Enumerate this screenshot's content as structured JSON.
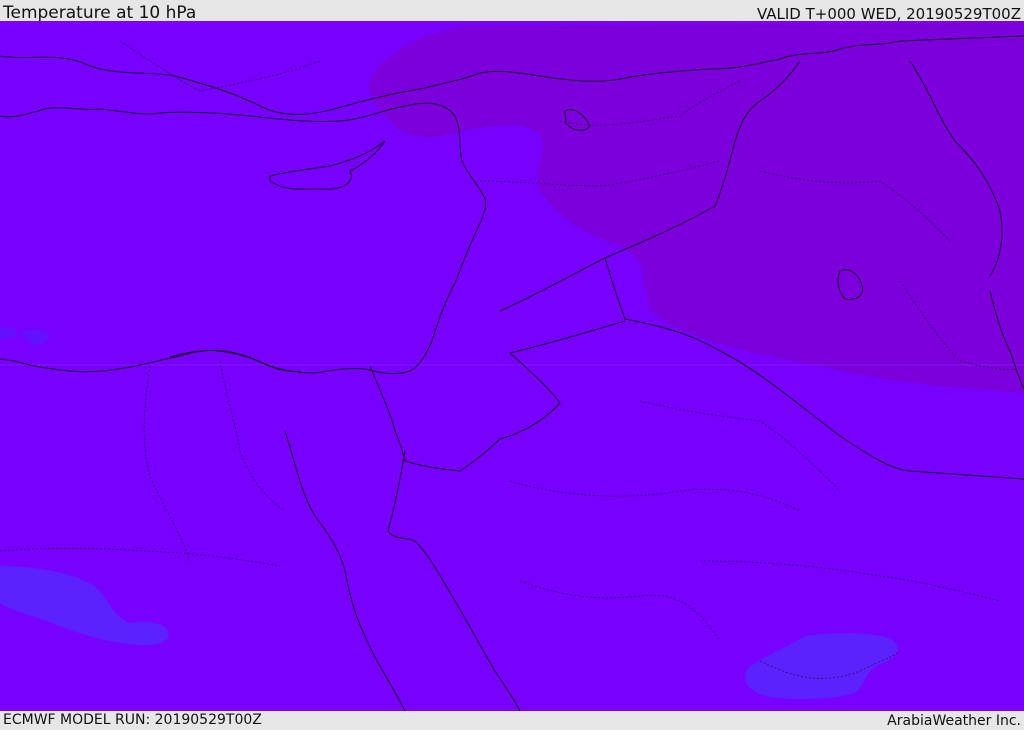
{
  "header": {
    "title": "Temperature at 10 hPa",
    "valid": "VALID T+000 WED, 20190529T00Z"
  },
  "footer": {
    "model_run": "ECMWF MODEL RUN: 20190529T00Z",
    "credit": "ArabiaWeather Inc."
  },
  "colors": {
    "field_base": "#7700ff",
    "field_cold_north_east": "#7c00dc",
    "field_warm_patch": "#5c21ff",
    "field_warm_patch_small": "#6310ff",
    "coastline": "#1a0a2a",
    "bar_background": "#e6e6e6"
  }
}
